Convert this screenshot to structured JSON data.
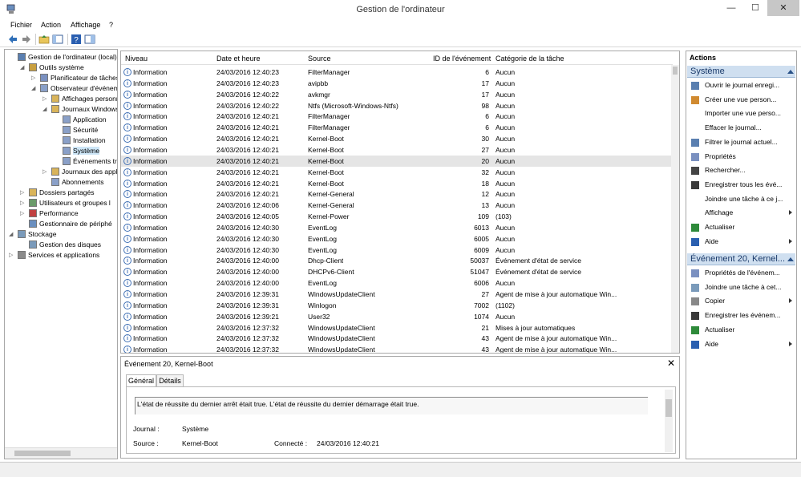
{
  "window": {
    "title": "Gestion de l'ordinateur",
    "min": "—",
    "max": "☐",
    "close": "✕"
  },
  "menu": [
    "Fichier",
    "Action",
    "Affichage",
    "?"
  ],
  "tree": [
    {
      "label": "Gestion de l'ordinateur (local)",
      "exp": ""
    },
    {
      "label": "Outils système",
      "exp": "◢"
    },
    {
      "label": "Planificateur de tâches",
      "exp": "▷"
    },
    {
      "label": "Observateur d'événeme",
      "exp": "◢"
    },
    {
      "label": "Affichages personna",
      "exp": "▷"
    },
    {
      "label": "Journaux Windows",
      "exp": "◢"
    },
    {
      "label": "Application",
      "exp": ""
    },
    {
      "label": "Sécurité",
      "exp": ""
    },
    {
      "label": "Installation",
      "exp": ""
    },
    {
      "label": "Système",
      "exp": ""
    },
    {
      "label": "Événements trar",
      "exp": ""
    },
    {
      "label": "Journaux des applica",
      "exp": "▷"
    },
    {
      "label": "Abonnements",
      "exp": ""
    },
    {
      "label": "Dossiers partagés",
      "exp": "▷"
    },
    {
      "label": "Utilisateurs et groupes l",
      "exp": "▷"
    },
    {
      "label": "Performance",
      "exp": "▷"
    },
    {
      "label": "Gestionnaire de périphé",
      "exp": ""
    },
    {
      "label": "Stockage",
      "exp": "◢"
    },
    {
      "label": "Gestion des disques",
      "exp": ""
    },
    {
      "label": "Services et applications",
      "exp": "▷"
    }
  ],
  "grid": {
    "columns": [
      "Niveau",
      "Date et heure",
      "Source",
      "ID de l'événement",
      "Catégorie de la tâche"
    ],
    "rows": [
      [
        "Information",
        "24/03/2016 12:40:23",
        "FilterManager",
        "6",
        "Aucun"
      ],
      [
        "Information",
        "24/03/2016 12:40:23",
        "avipbb",
        "17",
        "Aucun"
      ],
      [
        "Information",
        "24/03/2016 12:40:22",
        "avkmgr",
        "17",
        "Aucun"
      ],
      [
        "Information",
        "24/03/2016 12:40:22",
        "Ntfs (Microsoft-Windows-Ntfs)",
        "98",
        "Aucun"
      ],
      [
        "Information",
        "24/03/2016 12:40:21",
        "FilterManager",
        "6",
        "Aucun"
      ],
      [
        "Information",
        "24/03/2016 12:40:21",
        "FilterManager",
        "6",
        "Aucun"
      ],
      [
        "Information",
        "24/03/2016 12:40:21",
        "Kernel-Boot",
        "30",
        "Aucun"
      ],
      [
        "Information",
        "24/03/2016 12:40:21",
        "Kernel-Boot",
        "27",
        "Aucun"
      ],
      [
        "Information",
        "24/03/2016 12:40:21",
        "Kernel-Boot",
        "20",
        "Aucun"
      ],
      [
        "Information",
        "24/03/2016 12:40:21",
        "Kernel-Boot",
        "32",
        "Aucun"
      ],
      [
        "Information",
        "24/03/2016 12:40:21",
        "Kernel-Boot",
        "18",
        "Aucun"
      ],
      [
        "Information",
        "24/03/2016 12:40:21",
        "Kernel-General",
        "12",
        "Aucun"
      ],
      [
        "Information",
        "24/03/2016 12:40:06",
        "Kernel-General",
        "13",
        "Aucun"
      ],
      [
        "Information",
        "24/03/2016 12:40:05",
        "Kernel-Power",
        "109",
        "(103)"
      ],
      [
        "Information",
        "24/03/2016 12:40:30",
        "EventLog",
        "6013",
        "Aucun"
      ],
      [
        "Information",
        "24/03/2016 12:40:30",
        "EventLog",
        "6005",
        "Aucun"
      ],
      [
        "Information",
        "24/03/2016 12:40:30",
        "EventLog",
        "6009",
        "Aucun"
      ],
      [
        "Information",
        "24/03/2016 12:40:00",
        "Dhcp-Client",
        "50037",
        "Événement d'état de service"
      ],
      [
        "Information",
        "24/03/2016 12:40:00",
        "DHCPv6-Client",
        "51047",
        "Événement d'état de service"
      ],
      [
        "Information",
        "24/03/2016 12:40:00",
        "EventLog",
        "6006",
        "Aucun"
      ],
      [
        "Information",
        "24/03/2016 12:39:31",
        "WindowsUpdateClient",
        "27",
        "Agent de mise à jour automatique Win..."
      ],
      [
        "Information",
        "24/03/2016 12:39:31",
        "Winlogon",
        "7002",
        "(1102)"
      ],
      [
        "Information",
        "24/03/2016 12:39:21",
        "User32",
        "1074",
        "Aucun"
      ],
      [
        "Information",
        "24/03/2016 12:37:32",
        "WindowsUpdateClient",
        "21",
        "Mises à jour automatiques"
      ],
      [
        "Information",
        "24/03/2016 12:37:32",
        "WindowsUpdateClient",
        "43",
        "Agent de mise à jour automatique Win..."
      ],
      [
        "Information",
        "24/03/2016 12:37:32",
        "WindowsUpdateClient",
        "43",
        "Agent de mise à jour automatique Win..."
      ]
    ]
  },
  "detail": {
    "title": "Événement 20, Kernel-Boot",
    "close": "✕",
    "tabs": [
      "Général",
      "Détails"
    ],
    "description": "L'état de réussite du dernier arrêt était true. L'état de réussite du dernier démarrage était true.",
    "journal_label": "Journal :",
    "journal_value": "Système",
    "source_label": "Source :",
    "source_value": "Kernel-Boot",
    "connected_label": "Connecté :",
    "connected_value": "24/03/2016 12:40:21"
  },
  "actions": {
    "title": "Actions",
    "section1": "Système",
    "items1": [
      {
        "label": "Ouvrir le journal enregi...",
        "icon": "open-log-icon",
        "arrow": false
      },
      {
        "label": "Créer une vue person...",
        "icon": "filter-create-icon",
        "arrow": false
      },
      {
        "label": "Importer une vue perso...",
        "icon": "",
        "arrow": false
      },
      {
        "label": "Effacer le journal...",
        "icon": "",
        "arrow": false
      },
      {
        "label": "Filtrer le journal actuel...",
        "icon": "filter-icon",
        "arrow": false
      },
      {
        "label": "Propriétés",
        "icon": "properties-icon",
        "arrow": false
      },
      {
        "label": "Rechercher...",
        "icon": "find-icon",
        "arrow": false
      },
      {
        "label": "Enregistrer tous les évé...",
        "icon": "save-icon",
        "arrow": false
      },
      {
        "label": "Joindre une tâche à ce j...",
        "icon": "",
        "arrow": false
      },
      {
        "label": "Affichage",
        "icon": "",
        "arrow": true
      },
      {
        "label": "Actualiser",
        "icon": "refresh-icon",
        "arrow": false
      },
      {
        "label": "Aide",
        "icon": "help-icon",
        "arrow": true
      }
    ],
    "section2": "Événement 20, Kernel...",
    "items2": [
      {
        "label": "Propriétés de l'événem...",
        "icon": "event-properties-icon",
        "arrow": false
      },
      {
        "label": "Joindre une tâche à cet...",
        "icon": "attach-task-icon",
        "arrow": false
      },
      {
        "label": "Copier",
        "icon": "copy-icon",
        "arrow": true
      },
      {
        "label": "Enregistrer les événem...",
        "icon": "save-icon",
        "arrow": false
      },
      {
        "label": "Actualiser",
        "icon": "refresh-icon",
        "arrow": false
      },
      {
        "label": "Aide",
        "icon": "help-icon",
        "arrow": true
      }
    ]
  }
}
